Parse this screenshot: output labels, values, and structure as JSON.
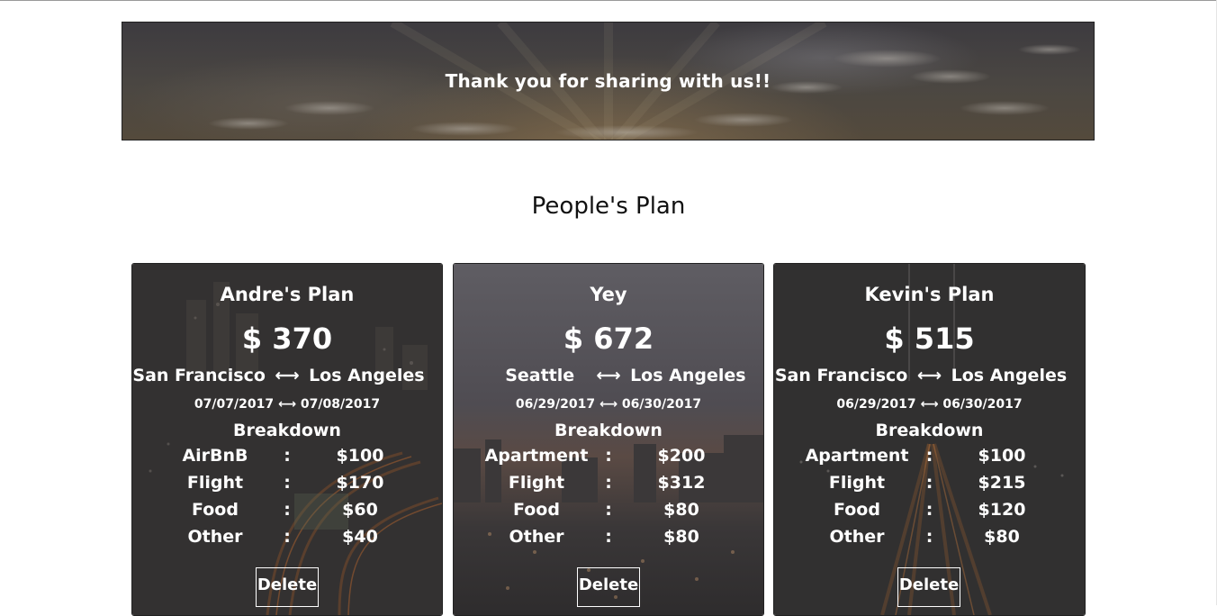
{
  "banner": {
    "message": "Thank you for sharing with us!!"
  },
  "section": {
    "title": "People's Plan"
  },
  "plans": [
    {
      "title": "Andre's Plan",
      "total": "$ 370",
      "from": "San Francisco",
      "to": "Los Angeles",
      "start_date": "07/07/2017",
      "end_date": "07/08/2017",
      "breakdown_label": "Breakdown",
      "items": [
        {
          "label": "AirBnB",
          "sep": ":",
          "value": "$100"
        },
        {
          "label": "Flight",
          "sep": ":",
          "value": "$170"
        },
        {
          "label": "Food",
          "sep": ":",
          "value": "$60"
        },
        {
          "label": "Other",
          "sep": ":",
          "value": "$40"
        }
      ],
      "delete_label": "Delete"
    },
    {
      "title": "Yey",
      "total": "$ 672",
      "from": "Seattle",
      "to": "Los Angeles",
      "start_date": "06/29/2017",
      "end_date": "06/30/2017",
      "breakdown_label": "Breakdown",
      "items": [
        {
          "label": "Apartment",
          "sep": ":",
          "value": "$200"
        },
        {
          "label": "Flight",
          "sep": ":",
          "value": "$312"
        },
        {
          "label": "Food",
          "sep": ":",
          "value": "$80"
        },
        {
          "label": "Other",
          "sep": ":",
          "value": "$80"
        }
      ],
      "delete_label": "Delete"
    },
    {
      "title": "Kevin's Plan",
      "total": "$ 515",
      "from": "San Francisco",
      "to": "Los Angeles",
      "start_date": "06/29/2017",
      "end_date": "06/30/2017",
      "breakdown_label": "Breakdown",
      "items": [
        {
          "label": "Apartment",
          "sep": ":",
          "value": "$100"
        },
        {
          "label": "Flight",
          "sep": ":",
          "value": "$215"
        },
        {
          "label": "Food",
          "sep": ":",
          "value": "$120"
        },
        {
          "label": "Other",
          "sep": ":",
          "value": "$80"
        }
      ],
      "delete_label": "Delete"
    }
  ],
  "icons": {
    "route_arrow": "left-right-arrow-icon"
  },
  "colors": {
    "card_dark": "#333131",
    "card_mid": "#4d4c52",
    "text": "#ffffff",
    "heading": "#111111"
  }
}
